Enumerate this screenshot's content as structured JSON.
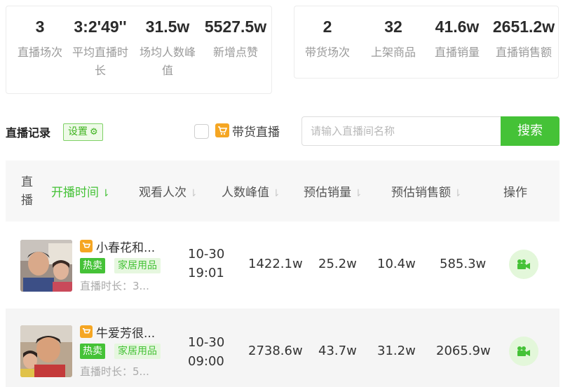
{
  "summary_left": [
    {
      "value": "3",
      "label": "直播场次"
    },
    {
      "value": "3:2'49''",
      "label": "平均直播时长"
    },
    {
      "value": "31.5w",
      "label": "场均人数峰值"
    },
    {
      "value": "5527.5w",
      "label": "新增点赞"
    }
  ],
  "summary_right": [
    {
      "value": "2",
      "label": "带货场次"
    },
    {
      "value": "32",
      "label": "上架商品"
    },
    {
      "value": "41.6w",
      "label": "直播销量"
    },
    {
      "value": "2651.2w",
      "label": "直播销售额"
    }
  ],
  "toolbar": {
    "section_title": "直播记录",
    "settings_label": "设置",
    "cart_filter_label": "带货直播",
    "search_placeholder": "请输入直播间名称",
    "search_button": "搜索"
  },
  "table": {
    "headers": {
      "live": "直播",
      "start_time": "开播时间",
      "views": "观看人次",
      "peak": "人数峰值",
      "sales": "预估销量",
      "revenue": "预估销售额",
      "action": "操作"
    },
    "rows": [
      {
        "title": "小春花和...",
        "hot_tag": "热卖",
        "category": "家居用品",
        "duration": "直播时长：3...",
        "date": "10-30",
        "time": "19:01",
        "views": "1422.1w",
        "peak": "25.2w",
        "sales": "10.4w",
        "revenue": "585.3w"
      },
      {
        "title": "牛爱芳很...",
        "hot_tag": "热卖",
        "category": "家居用品",
        "duration": "直播时长：5...",
        "date": "10-30",
        "time": "09:00",
        "views": "2738.6w",
        "peak": "43.7w",
        "sales": "31.2w",
        "revenue": "2065.9w"
      }
    ]
  },
  "colors": {
    "accent": "#45c237",
    "cart_orange": "#f5a623",
    "muted": "#9a9a9a"
  },
  "icons": {
    "settings": "gear-icon",
    "cart": "shopping-cart-icon",
    "sort": "sort-down-icon",
    "action": "video-camera-icon"
  }
}
